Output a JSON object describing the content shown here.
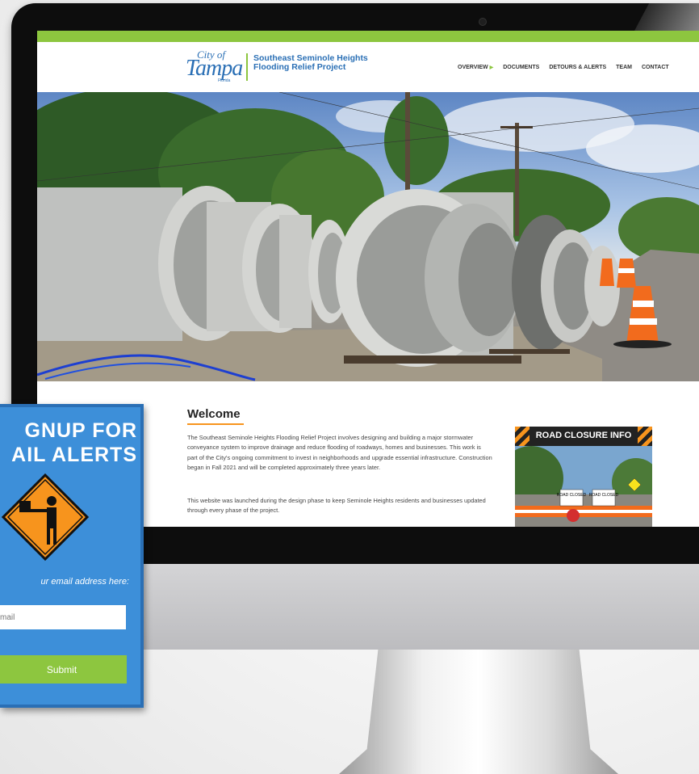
{
  "site": {
    "logo": {
      "city": "City of",
      "tampa": "Tampa",
      "state": "Florida"
    },
    "project_title_line1": "Southeast Seminole Heights",
    "project_title_line2": "Flooding Relief Project",
    "nav": [
      {
        "label": "OVERVIEW"
      },
      {
        "label": "DOCUMENTS"
      },
      {
        "label": "DETOURS & ALERTS"
      },
      {
        "label": "TEAM"
      },
      {
        "label": "CONTACT"
      }
    ],
    "brand_green": "#8dc63f",
    "brand_blue": "#2a6fb5"
  },
  "main": {
    "heading": "Welcome",
    "paragraph1": "The Southeast Seminole Heights Flooding Relief Project involves designing and building a major stormwater conveyance system to improve drainage and reduce flooding of roadways, homes and businesses. This work is part of the City's ongoing commitment to invest in neighborhoods and upgrade essential infrastructure. Construction began in Fall 2021 and will be completed approximately three years later.",
    "paragraph2": "This website was launched during the design phase to keep Seminole Heights residents and businesses updated through every phase of the project."
  },
  "road_closure": {
    "title": "ROAD CLOSURE INFO",
    "sign1": "ROAD CLOSED",
    "sign2": "ROAD CLOSED"
  },
  "signup": {
    "title_line1": "GNUP FOR",
    "title_line2": "AIL ALERTS",
    "prompt": "ur email address here:",
    "input_placeholder": "mail",
    "submit_label": "Submit"
  }
}
